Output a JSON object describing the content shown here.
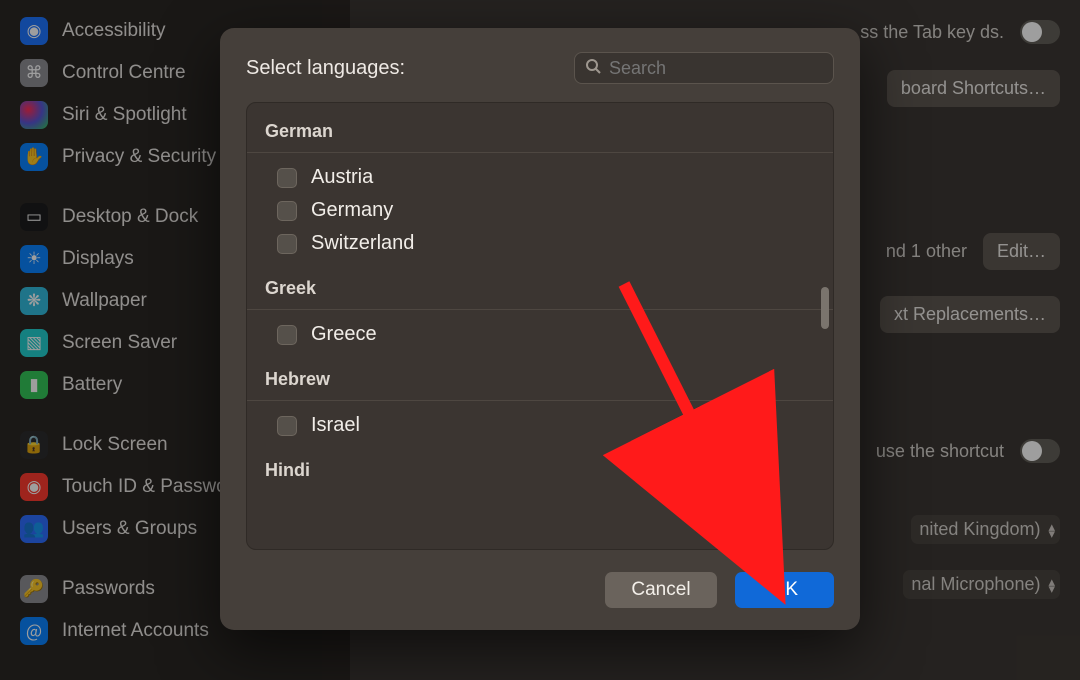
{
  "sidebar": {
    "items": [
      {
        "label": "Accessibility",
        "icon": "accessibility-icon"
      },
      {
        "label": "Control Centre",
        "icon": "controlcenter-icon"
      },
      {
        "label": "Siri & Spotlight",
        "icon": "siri-icon"
      },
      {
        "label": "Privacy & Security",
        "icon": "privacy-icon"
      },
      {
        "label": "Desktop & Dock",
        "icon": "dock-icon"
      },
      {
        "label": "Displays",
        "icon": "displays-icon"
      },
      {
        "label": "Wallpaper",
        "icon": "wallpaper-icon"
      },
      {
        "label": "Screen Saver",
        "icon": "screensaver-icon"
      },
      {
        "label": "Battery",
        "icon": "battery-icon"
      },
      {
        "label": "Lock Screen",
        "icon": "lockscreen-icon"
      },
      {
        "label": "Touch ID & Password",
        "icon": "touchid-icon"
      },
      {
        "label": "Users & Groups",
        "icon": "users-icon"
      },
      {
        "label": "Passwords",
        "icon": "passwords-icon"
      },
      {
        "label": "Internet Accounts",
        "icon": "internetaccounts-icon"
      }
    ],
    "group_breaks": [
      3,
      8,
      11
    ]
  },
  "main": {
    "tab_hint": "ss the Tab key ds.",
    "shortcuts_btn": "board Shortcuts…",
    "input_value": "nd 1 other",
    "edit_btn": "Edit…",
    "replacements_btn": "xt Replacements…",
    "shortcut_hint": "use the shortcut",
    "dictation_lang": "nited Kingdom)",
    "mic_src": "nal Microphone)"
  },
  "modal": {
    "title": "Select languages:",
    "search_placeholder": "Search",
    "ok": "OK",
    "cancel": "Cancel",
    "groups": [
      {
        "header": "German",
        "items": [
          "Austria",
          "Germany",
          "Switzerland"
        ]
      },
      {
        "header": "Greek",
        "items": [
          "Greece"
        ]
      },
      {
        "header": "Hebrew",
        "items": [
          "Israel"
        ]
      },
      {
        "header": "Hindi",
        "items": []
      }
    ]
  },
  "colors": {
    "accent": "#1069d8"
  }
}
